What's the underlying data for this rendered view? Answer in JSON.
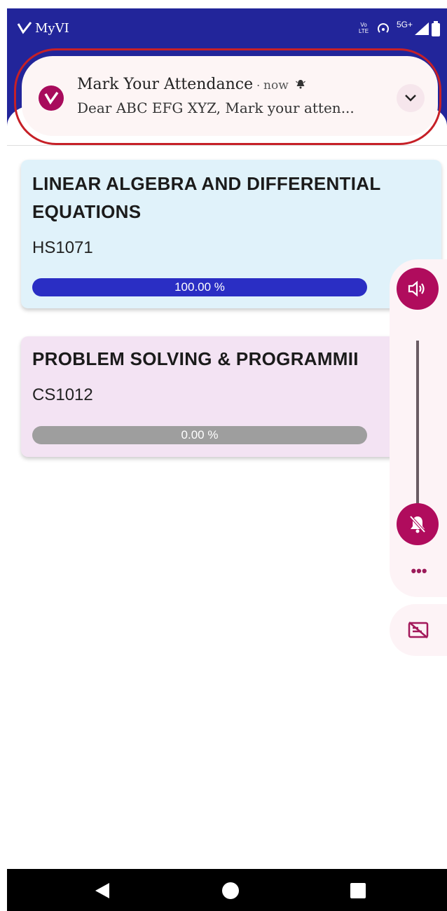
{
  "status_bar": {
    "app_name": "MyVI",
    "volte_label": "Vo LTE",
    "network_label": "5G+"
  },
  "notification": {
    "title": "Mark Your Attendance",
    "separator": "·",
    "time": "now",
    "body": "Dear ABC EFG XYZ, Mark your atten..."
  },
  "courses": [
    {
      "name": "LINEAR ALGEBRA AND DIFFERENTIAL EQUATIONS",
      "code": "HS1071",
      "progress_label": "100.00 %",
      "progress": 1.0,
      "bar_color": "#2a2ec4"
    },
    {
      "name": "PROBLEM SOLVING & PROGRAMMII",
      "code": "CS1012",
      "progress_label": "0.00 %",
      "progress": 0.0,
      "bar_color": "#9e9e9e"
    }
  ],
  "colors": {
    "header": "#22259a",
    "accent": "#b00c5d",
    "highlight_outline": "#c62027"
  },
  "icons": {
    "app": "vi-logo-icon",
    "notification_bell": "bell-icon",
    "expand": "chevron-down-icon",
    "volume": "volume-icon",
    "ringer_off": "ringer-off-icon",
    "more": "more-horizontal-icon",
    "captions": "captions-off-icon",
    "nav_back": "back-triangle-icon",
    "nav_home": "home-circle-icon",
    "nav_recents": "recents-square-icon"
  }
}
